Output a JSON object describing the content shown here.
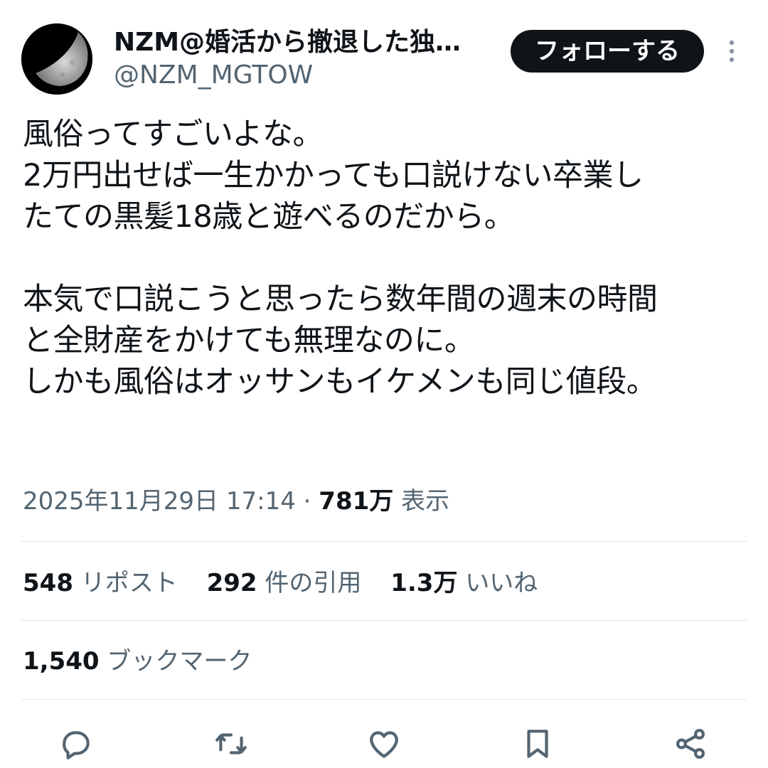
{
  "user": {
    "display_name": "NZM@婚活から撤退した独…",
    "handle": "@NZM_MGTOW"
  },
  "follow_button": {
    "label": "フォローする"
  },
  "tweet": {
    "lines": [
      "風俗ってすごいよな。",
      "2万円出せば一生かかっても口説けない卒業し",
      "たての黒髪18歳と遊べるのだから。",
      "",
      "本気で口説こうと思ったら数年間の週末の時間",
      "と全財産をかけても無理なのに。",
      "しかも風俗はオッサンもイケメンも同じ値段。"
    ]
  },
  "meta": {
    "timestamp": "2025年11月29日 17:14",
    "separator": " · ",
    "views_count": "781万",
    "views_label": " 表示"
  },
  "stats": {
    "reposts": {
      "count": "548",
      "label": "リポスト"
    },
    "quotes": {
      "count": "292",
      "label": "件の引用"
    },
    "likes": {
      "count": "1.3万",
      "label": "いいね"
    },
    "bookmarks": {
      "count": "1,540",
      "label": "ブックマーク"
    }
  },
  "icons": {
    "more": "more-vertical-icon",
    "reply": "reply-icon",
    "repost": "repost-icon",
    "like": "heart-icon",
    "bookmark": "bookmark-icon",
    "share": "share-icon"
  },
  "colors": {
    "text": "#0f1419",
    "secondary": "#536471",
    "divider": "#e1e6ea",
    "button_bg": "#0f1419"
  }
}
